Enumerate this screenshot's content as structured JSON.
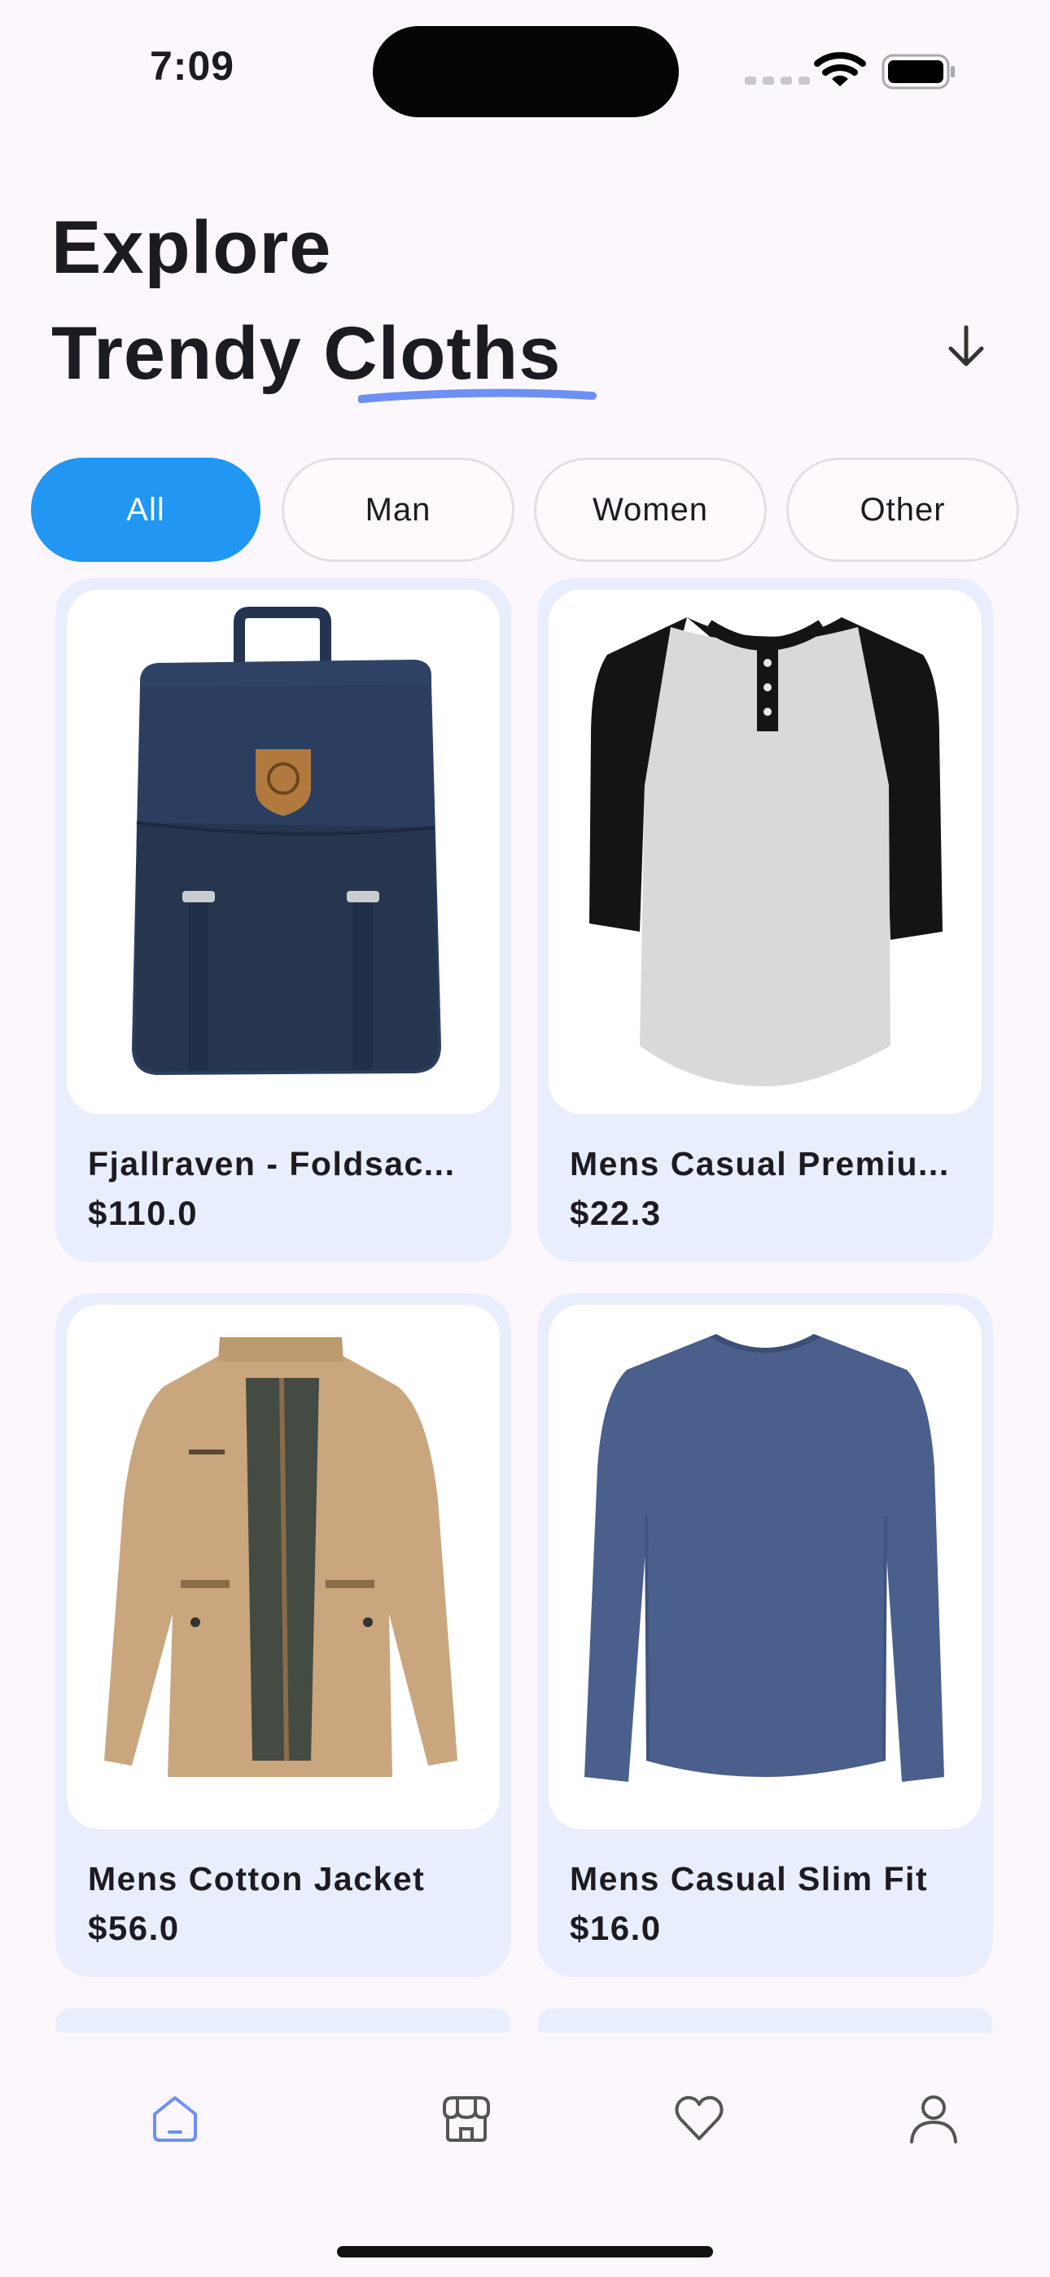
{
  "status_bar": {
    "time": "7:09"
  },
  "header": {
    "title_line1": "Explore",
    "title_line2": "Trendy Cloths",
    "accent_color": "#6e8ff3"
  },
  "filters": [
    {
      "label": "All",
      "selected": true
    },
    {
      "label": "Man",
      "selected": false
    },
    {
      "label": "Women",
      "selected": false
    },
    {
      "label": "Other",
      "selected": false
    }
  ],
  "products": [
    {
      "name": "Fjallraven - Foldsac...",
      "price": "$110.0",
      "image": "navy-backpack"
    },
    {
      "name": "Mens Casual Premiu...",
      "price": "$22.3",
      "image": "raglan-henley-tshirt"
    },
    {
      "name": "Mens Cotton Jacket",
      "price": "$56.0",
      "image": "beige-cotton-jacket"
    },
    {
      "name": "Mens Casual Slim Fit",
      "price": "$16.0",
      "image": "blue-longsleeve-tshirt"
    }
  ],
  "bottom_nav": [
    {
      "icon": "home-icon",
      "active": true
    },
    {
      "icon": "store-icon",
      "active": false
    },
    {
      "icon": "heart-icon",
      "active": false
    },
    {
      "icon": "profile-icon",
      "active": false
    }
  ],
  "colors": {
    "chip_active": "#2196f3",
    "card_bg": "#e9eefc",
    "nav_active": "#6e8ff3"
  }
}
